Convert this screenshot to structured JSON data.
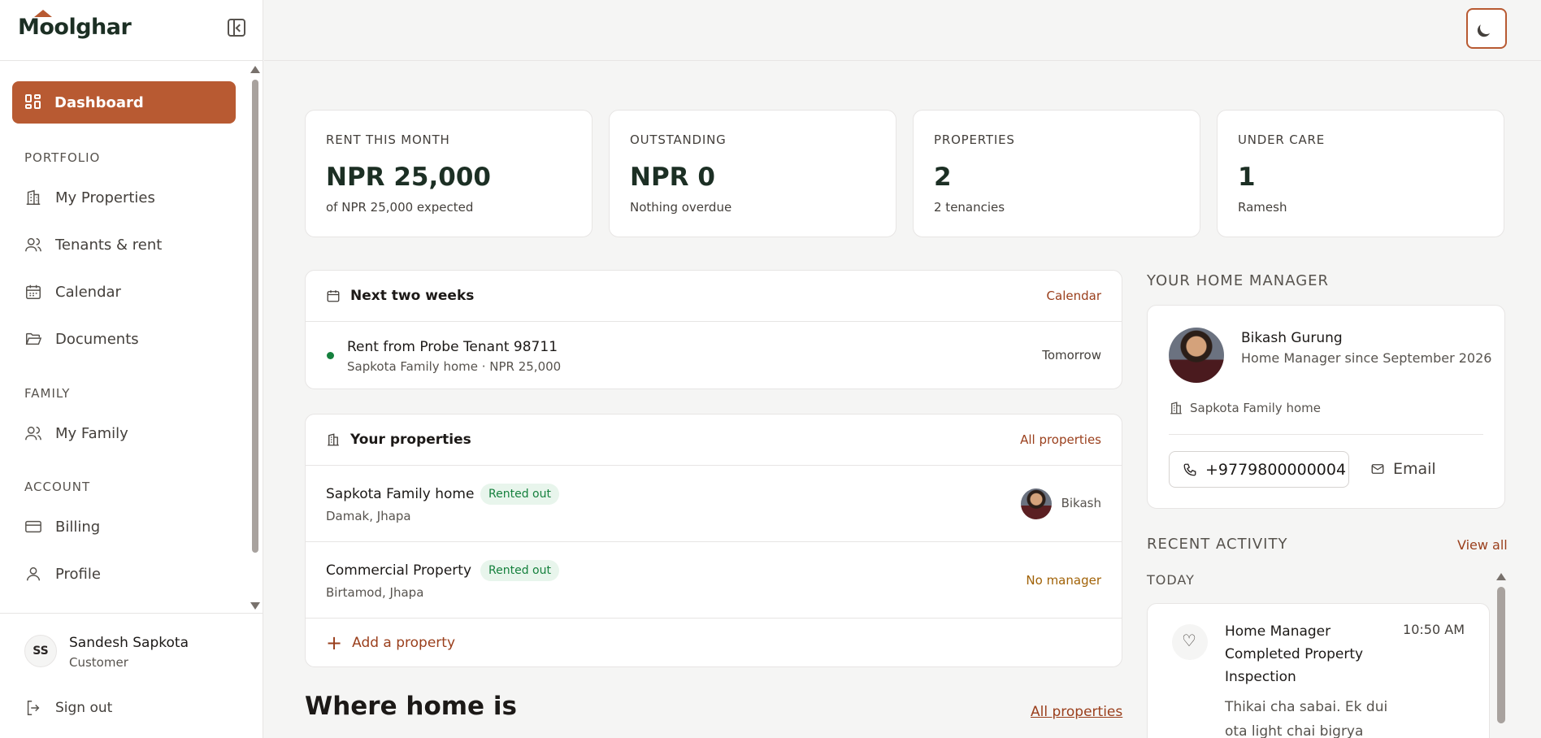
{
  "app": {
    "logo_text": "Moolghar"
  },
  "sidebar": {
    "active_item": "Dashboard",
    "sections": {
      "portfolio": "PORTFOLIO",
      "family": "FAMILY",
      "account": "ACCOUNT"
    },
    "items": {
      "my_properties": "My Properties",
      "tenants": "Tenants & rent",
      "calendar": "Calendar",
      "documents": "Documents",
      "my_family": "My Family",
      "billing": "Billing",
      "profile": "Profile"
    },
    "user": {
      "initials": "SS",
      "name": "Sandesh Sapkota",
      "role": "Customer"
    },
    "sign_out": "Sign out"
  },
  "stats": [
    {
      "label": "RENT THIS MONTH",
      "value": "NPR 25,000",
      "sub": "of NPR 25,000 expected"
    },
    {
      "label": "OUTSTANDING",
      "value": "NPR 0",
      "sub": "Nothing overdue"
    },
    {
      "label": "PROPERTIES",
      "value": "2",
      "sub": "2 tenancies"
    },
    {
      "label": "UNDER CARE",
      "value": "1",
      "sub": "Ramesh"
    }
  ],
  "upcoming": {
    "title": "Next two weeks",
    "link": "Calendar",
    "items": [
      {
        "title": "Rent from Probe Tenant 98711",
        "sub": "Sapkota Family home · NPR 25,000",
        "when": "Tomorrow",
        "status_color": "#15803d"
      }
    ]
  },
  "properties": {
    "title": "Your properties",
    "link": "All properties",
    "items": [
      {
        "name": "Sapkota Family home",
        "badge": "Rented out",
        "location": "Damak, Jhapa",
        "manager": "Bikash"
      },
      {
        "name": "Commercial Property",
        "badge": "Rented out",
        "location": "Birtamod, Jhapa",
        "manager": "No manager"
      }
    ],
    "add_label": "Add a property"
  },
  "where_home": {
    "heading": "Where home is",
    "link": "All properties"
  },
  "home_manager": {
    "section_title": "YOUR HOME MANAGER",
    "name": "Bikash Gurung",
    "since": "Home Manager since September 2026",
    "property": "Sapkota Family home",
    "phone": "+9779800000004",
    "email_label": "Email"
  },
  "activity": {
    "section_title": "RECENT ACTIVITY",
    "link": "View all",
    "day": "TODAY",
    "items": [
      {
        "title_line1": "Home Manager",
        "title_line2": "Completed Property",
        "title_line3": "Inspection",
        "time": "10:50 AM",
        "body_line1": "Thikai cha sabai. Ek dui",
        "body_line2": "ota light chai bigrya"
      }
    ]
  },
  "colors": {
    "accent": "#b85a32",
    "link": "#9a3f1c",
    "success": "#15803d",
    "background": "#f5f5f4"
  }
}
